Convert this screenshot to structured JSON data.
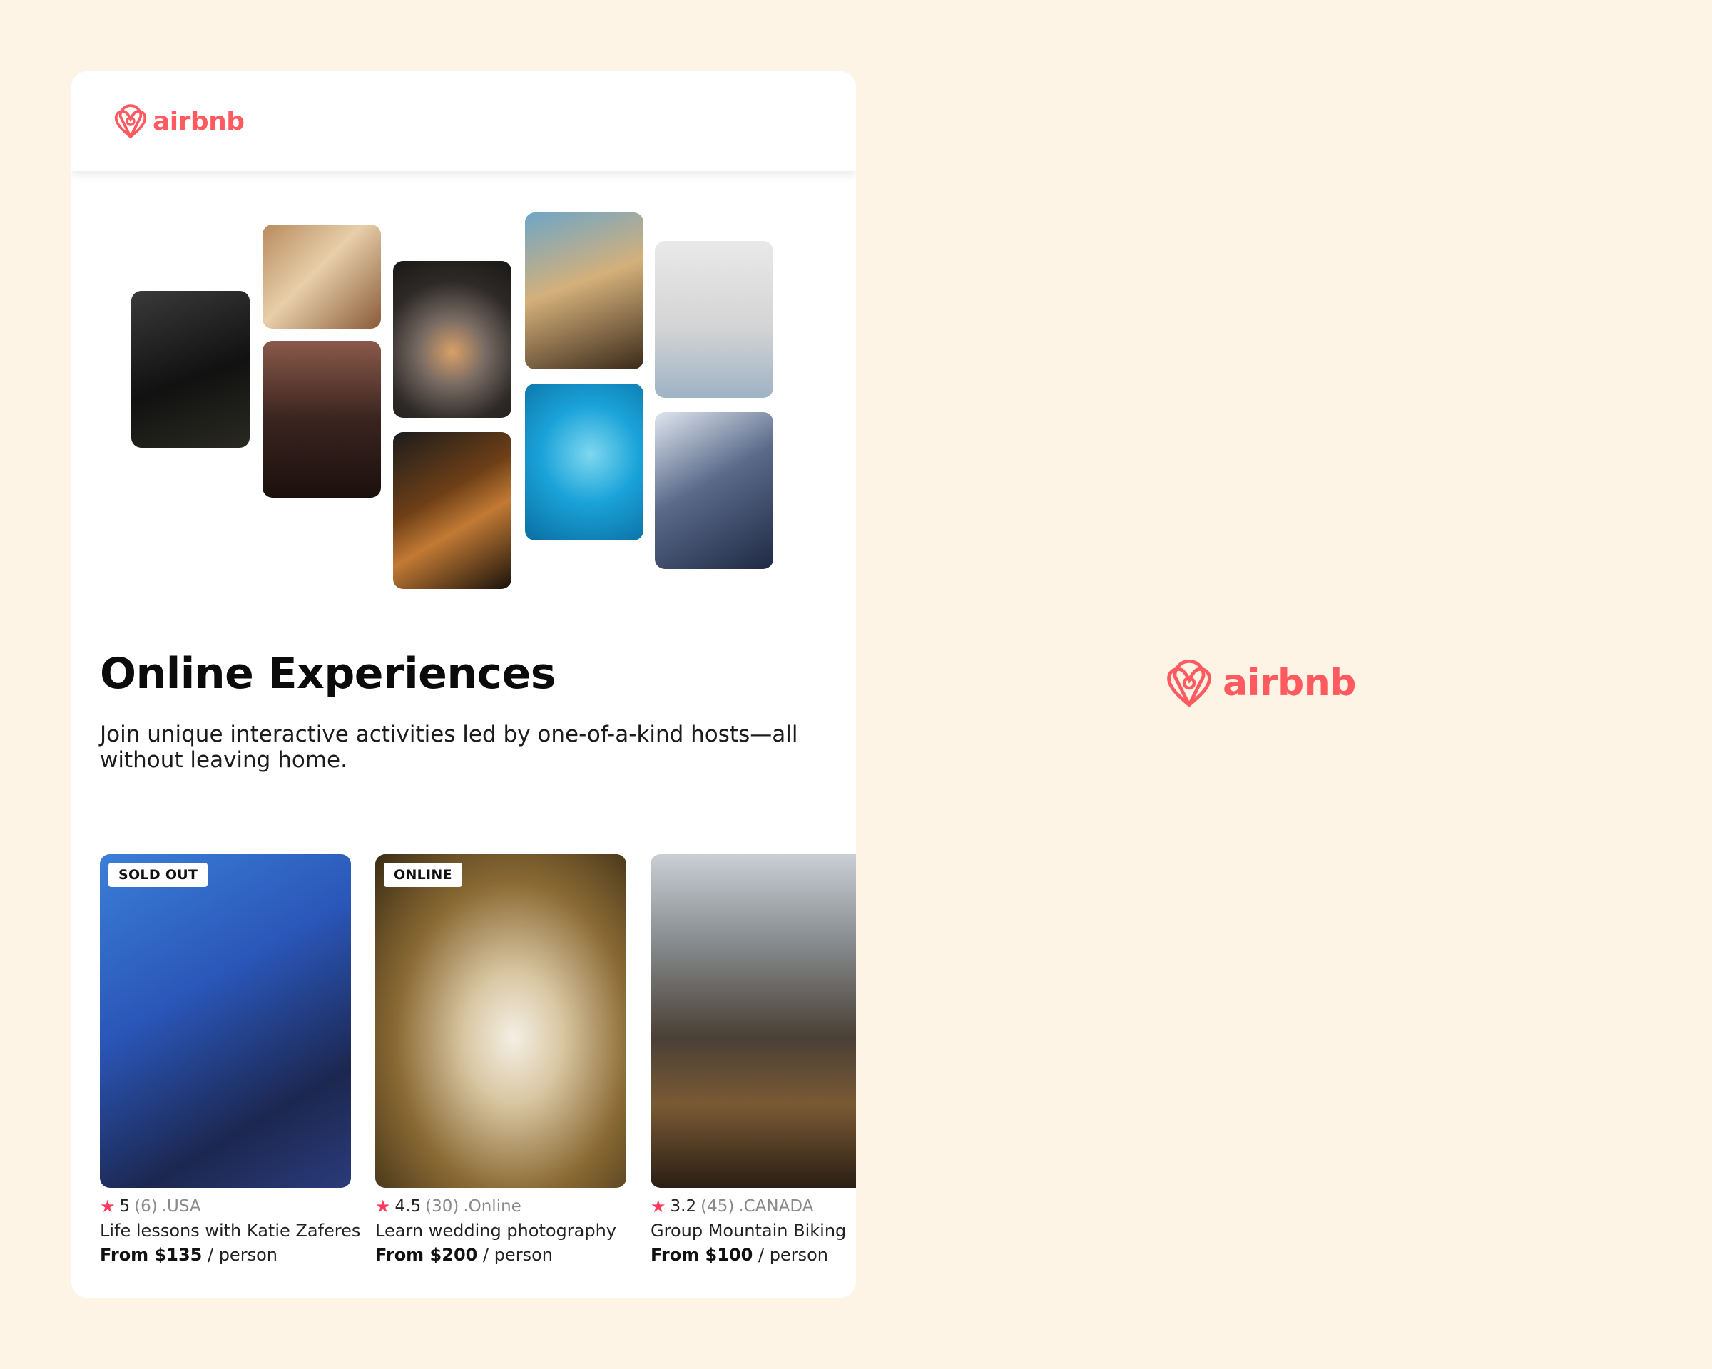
{
  "brand": {
    "name": "airbnb",
    "color": "#FF5A5F",
    "icon": "airbnb-belo-icon"
  },
  "colors": {
    "page_background": "#FDF4E6",
    "card_background": "#FFFFFF",
    "star": "#FF385C"
  },
  "collage": {
    "photos": [
      {
        "name": "cooking-photo",
        "icon": "pans-on-stove"
      },
      {
        "name": "woman-holding-food-photo",
        "icon": "portrait"
      },
      {
        "name": "dancer-in-doorway-photo",
        "icon": "dancer"
      },
      {
        "name": "food-bowl-photo",
        "icon": "bowl"
      },
      {
        "name": "guitar-photo",
        "icon": "guitar"
      },
      {
        "name": "piano-and-microphone-photo",
        "icon": "piano"
      },
      {
        "name": "swimmer-photo",
        "icon": "swimmer"
      },
      {
        "name": "yoga-photo",
        "icon": "yoga"
      },
      {
        "name": "singer-photo",
        "icon": "singer"
      }
    ]
  },
  "hero": {
    "title": "Online Experiences",
    "subtitle": "Join unique interactive activities led by one-of-a-kind hosts—all without leaving home."
  },
  "experiences": [
    {
      "badge": "SOLD OUT",
      "rating": "5",
      "reviews": "(6)",
      "location": ".USA",
      "title": "Life lessons with Katie Zaferes",
      "price": "From $135",
      "unit": "/ person",
      "image": "triathlete-photo"
    },
    {
      "badge": "ONLINE",
      "rating": "4.5",
      "reviews": "(30)",
      "location": ".Online",
      "title": "Learn wedding photography",
      "price": "From $200",
      "unit": "/ person",
      "image": "bride-photo"
    },
    {
      "badge": "",
      "rating": "3.2",
      "reviews": "(45)",
      "location": ".CANADA",
      "title": "Group Mountain Biking",
      "price": "From $100",
      "unit": "/ person",
      "image": "mountain-bike-photo"
    }
  ]
}
